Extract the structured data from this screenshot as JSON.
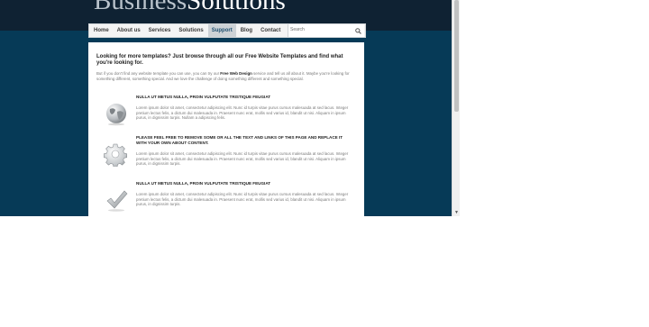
{
  "logo": {
    "part1": "Business",
    "part2": "Solutions"
  },
  "nav": {
    "items": [
      {
        "label": "Home"
      },
      {
        "label": "About us"
      },
      {
        "label": "Services"
      },
      {
        "label": "Solutions"
      },
      {
        "label": "Support",
        "active": true
      },
      {
        "label": "Blog"
      },
      {
        "label": "Contact"
      }
    ]
  },
  "search": {
    "placeholder": "Search",
    "icon": "search-icon"
  },
  "content": {
    "headline": "Looking for more templates? Just browse through all our Free Website Templates and find what you're looking for.",
    "intro_before": "But if you don't find any website template you can use, you can try our ",
    "intro_link": "Free Web Design",
    "intro_after": " service and tell us all about it. Maybe you're looking for something different, something special. And we love the challenge of doing something different and something special.",
    "features": [
      {
        "icon": "globe-icon",
        "title": "NULLA UT METUS NULLA, PROIN VULPUTATE TRISTIQUE FEUGIAT",
        "body": "Lorem ipsum dolor sit amet, consectetur adipiscing elit. Nunc id turpis vitae purus cursus malesuada at sed lacus. Integer pretium lectus felis, a dictum dui malesuada in. Praesent nunc erat, mollis sed varius id, blandit ut nisi. Aliquam in ipsum purus, in dignissim turpis. Nullam a adipiscing felis."
      },
      {
        "icon": "gear-icon",
        "title": "PLEASE FEEL FREE TO REMOVE SOME OR ALL THE TEXT AND LINKS OF THIS PAGE AND REPLACE IT WITH YOUR OWN ABOUT CONTENT.",
        "body": "Lorem ipsum dolor sit amet, consectetur adipiscing elit. Nunc id turpis vitae purus cursus malesuada at sed lacus. Integer pretium lectus felis, a dictum dui malesuada in. Praesent nunc erat, mollis sed varius id, blandit ut nisi. Aliquam in ipsum purus, in dignissim turpis."
      },
      {
        "icon": "checkmark-icon",
        "title": "NULLA UT METUS NULLA, PROIN VULPUTATE TRISTIQUE FEUGIAT",
        "body": "Lorem ipsum dolor sit amet, consectetur adipiscing elit. Nunc id turpis vitae purus cursus malesuada at sed lacus. Integer pretium lectus felis, a dictum dui malesuada in. Praesent nunc erat, mollis sed varius id, blandit ut nisi. Aliquam in ipsum purus, in dignissim turpis."
      }
    ]
  },
  "colors": {
    "header_bg": "#0f2233",
    "band_bg": "#063a57",
    "nav_active_bg": "#cdd2d6",
    "nav_active_text": "#1e4f70"
  }
}
